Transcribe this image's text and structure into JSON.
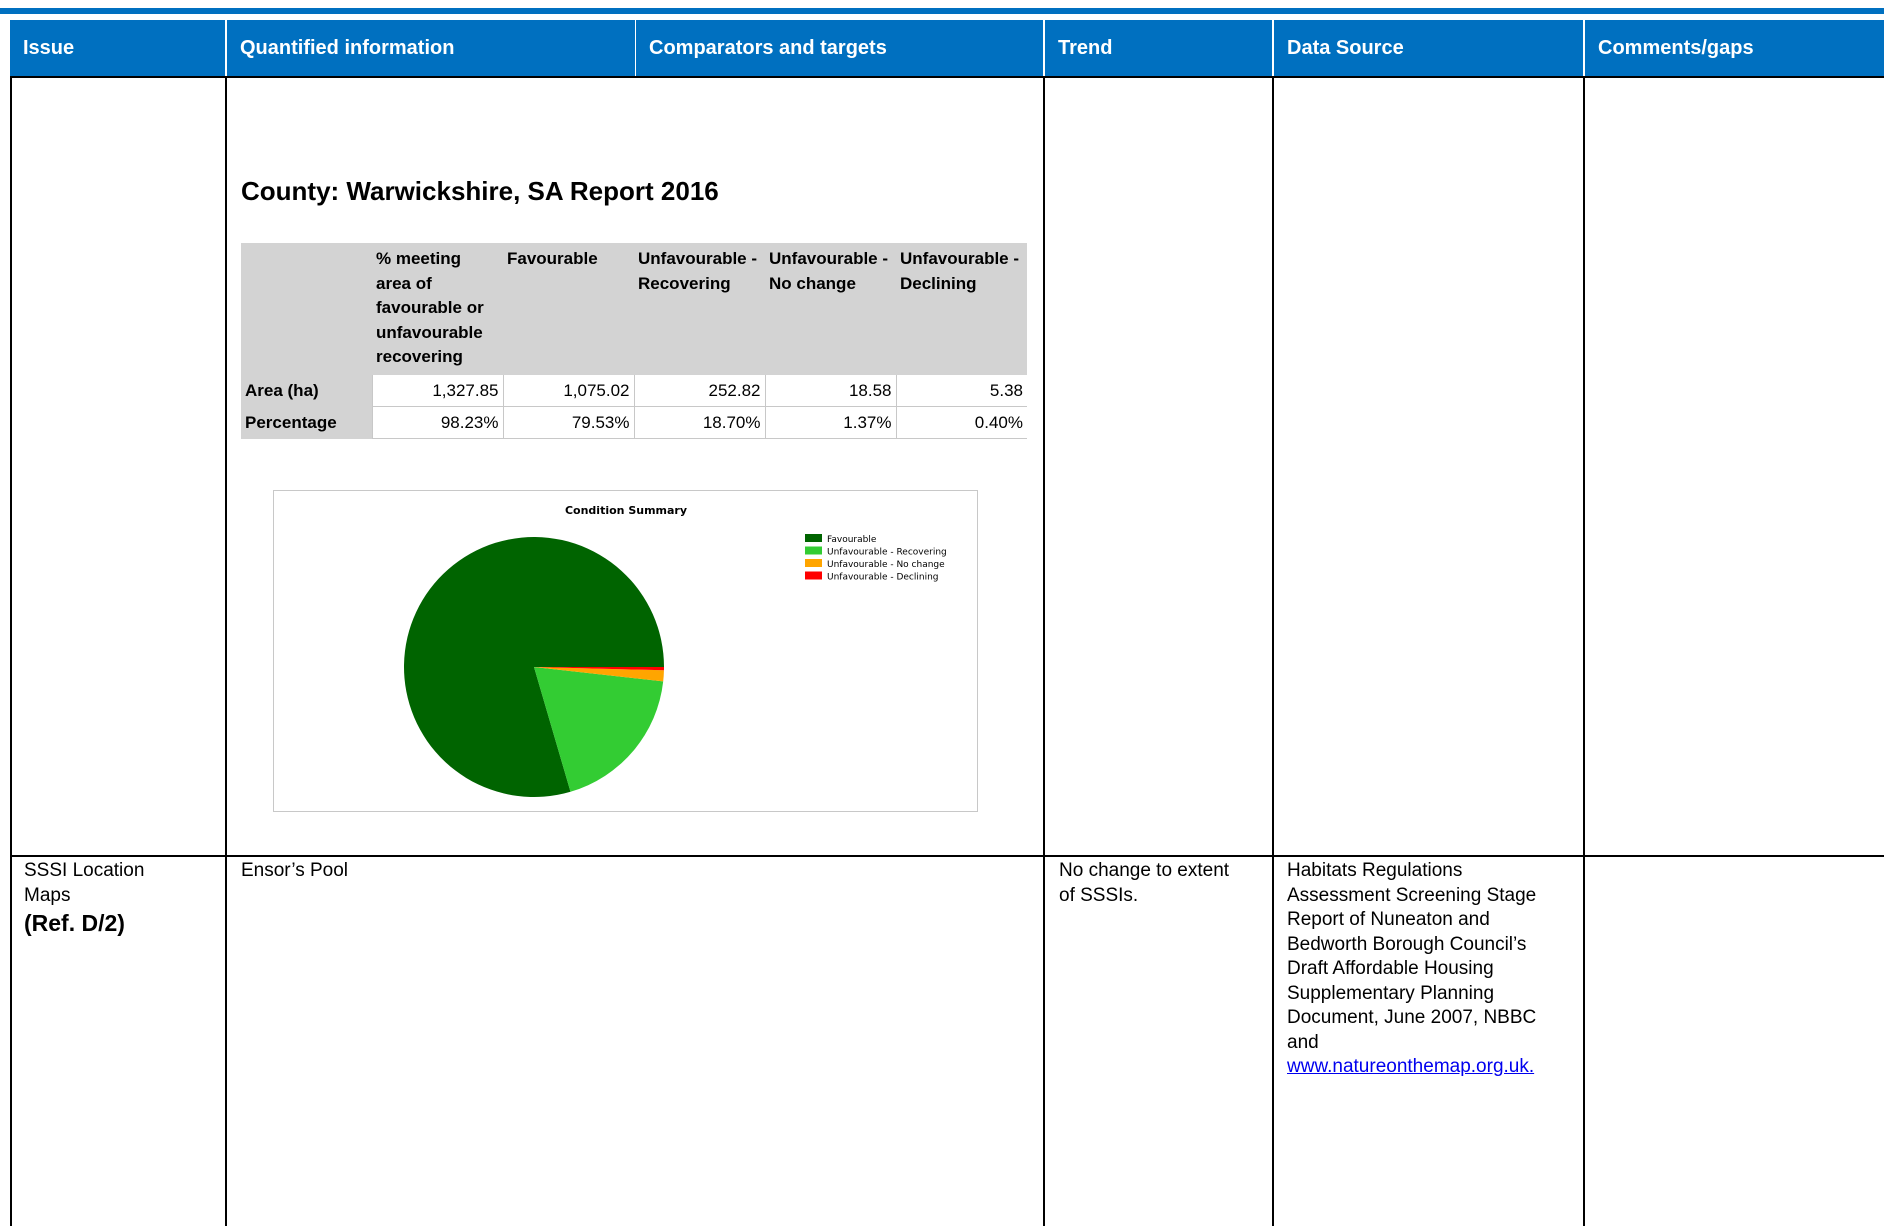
{
  "header": {
    "issue": "Issue",
    "quantified": "Quantified information",
    "comparators": "Comparators and targets",
    "trend": "Trend",
    "data_source": "Data Source",
    "comments": "Comments/gaps"
  },
  "section1": {
    "county_title": "County: Warwickshire, SA Report 2016",
    "table": {
      "columns": [
        "% meeting area of favourable or unfavourable recovering",
        "Favourable",
        "Unfavourable - Recovering",
        "Unfavourable - No change",
        "Unfavourable - Declining"
      ],
      "column_lines": [
        [
          "% meeting",
          "area of",
          "favourable or",
          "unfavourable",
          "recovering"
        ],
        [
          "Favourable"
        ],
        [
          "Unfavourable -",
          "Recovering"
        ],
        [
          "Unfavourable -",
          "No change"
        ],
        [
          "Unfavourable -",
          "Declining"
        ]
      ],
      "rows": [
        {
          "label": "Area (ha)",
          "values": [
            "1,327.85",
            "1,075.02",
            "252.82",
            "18.58",
            "5.38"
          ]
        },
        {
          "label": "Percentage",
          "values": [
            "98.23%",
            "79.53%",
            "18.70%",
            "1.37%",
            "0.40%"
          ]
        }
      ]
    }
  },
  "chart_data": {
    "type": "pie",
    "title": "Condition Summary",
    "categories": [
      "Favourable",
      "Unfavourable - Recovering",
      "Unfavourable - No change",
      "Unfavourable - Declining"
    ],
    "values": [
      79.53,
      18.7,
      1.37,
      0.4
    ],
    "colors": [
      "#006400",
      "#33cc33",
      "#ffa500",
      "#ff0000"
    ],
    "legend_position": "top-right"
  },
  "section2": {
    "issue_line1": "SSSI Location",
    "issue_line2": "Maps",
    "issue_ref": "(Ref. D/2)",
    "quantified": "Ensor’s Pool",
    "trend_lines": [
      "No change to extent",
      "of SSSIs."
    ],
    "data_source_lines": [
      "Habitats Regulations",
      "Assessment Screening Stage",
      "Report of Nuneaton and",
      "Bedworth Borough Council’s",
      "Draft Affordable Housing",
      "Supplementary Planning",
      "Document, June 2007, NBBC",
      "and"
    ],
    "data_source_link": "www.natureonthemap.org.uk."
  }
}
